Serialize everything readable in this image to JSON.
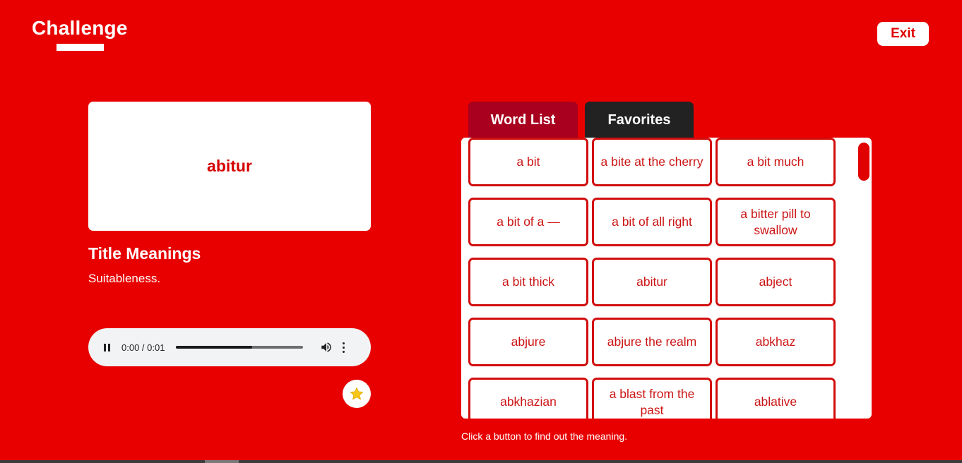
{
  "header": {
    "title": "Challenge",
    "exit_label": "Exit"
  },
  "card": {
    "word": "abitur"
  },
  "meaning": {
    "title": "Title Meanings",
    "text": "Suitableness."
  },
  "audio": {
    "time": "0:00 / 0:01",
    "progress_fraction": 0.6
  },
  "tabs": {
    "word_list": "Word List",
    "favorites": "Favorites"
  },
  "words": [
    "a bit",
    "a bite at the cherry",
    "a bit much",
    "a bit of a —",
    "a bit of all right",
    "a bitter pill to swallow",
    "a bit thick",
    "abitur",
    "abject",
    "abjure",
    "abjure the realm",
    "abkhaz",
    "abkhazian",
    "a blast from the past",
    "ablative"
  ],
  "hint": "Click a button to find out the meaning.",
  "colors": {
    "background": "#e80000",
    "accent": "#d10d0d",
    "tab_active": "#a8001e",
    "tab_inactive": "#222222",
    "star": "#f5c518"
  },
  "icons": {
    "pause": "pause-icon",
    "volume": "volume-icon",
    "menu": "more-vert-icon",
    "favorite": "star-icon"
  }
}
